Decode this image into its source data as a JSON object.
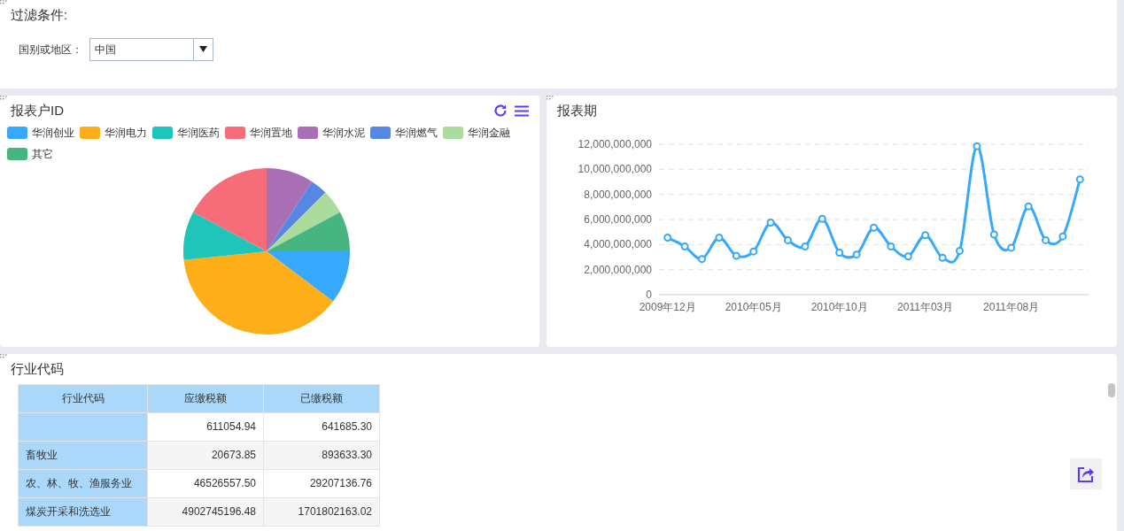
{
  "filter_panel": {
    "title": "过滤条件:",
    "field_label": "国别或地区：",
    "select_value": "中国"
  },
  "pie_panel": {
    "title": "报表户ID",
    "legend": [
      {
        "label": "华润创业",
        "color": "#36a9fd"
      },
      {
        "label": "华润电力",
        "color": "#fdae19"
      },
      {
        "label": "华润医药",
        "color": "#1ec5b8"
      },
      {
        "label": "华润置地",
        "color": "#f66c78"
      },
      {
        "label": "华润水泥",
        "color": "#a86fb5"
      },
      {
        "label": "华润燃气",
        "color": "#5687e2"
      },
      {
        "label": "华润金融",
        "color": "#abdc9e"
      },
      {
        "label": "其它",
        "color": "#47b57f"
      }
    ]
  },
  "line_panel": {
    "title": "报表期",
    "chart_data": {
      "type": "line",
      "categories": [
        "2009年12月",
        null,
        null,
        null,
        null,
        "2010年05月",
        null,
        null,
        null,
        null,
        "2010年10月",
        null,
        null,
        null,
        null,
        "2011年03月",
        null,
        null,
        null,
        null,
        "2011年08月",
        null,
        null,
        null,
        null
      ],
      "grid": true,
      "ylim": [
        0,
        12000000000
      ],
      "yticks": [
        {
          "value": 0,
          "label": "0"
        },
        {
          "value": 2000000000,
          "label": "2,000,000,000"
        },
        {
          "value": 4000000000,
          "label": "4,000,000,000"
        },
        {
          "value": 6000000000,
          "label": "6,000,000,000"
        },
        {
          "value": 8000000000,
          "label": "8,000,000,000"
        },
        {
          "value": 10000000000,
          "label": "10,000,000,000"
        },
        {
          "value": 12000000000,
          "label": "12,000,000,000"
        }
      ],
      "series": [
        {
          "color": "#36a9fd",
          "marker": "circle",
          "values": [
            4550000000,
            3850000000,
            2850000000,
            4550000000,
            3100000000,
            3450000000,
            5750000000,
            4350000000,
            3850000000,
            6050000000,
            3350000000,
            3200000000,
            5350000000,
            3850000000,
            3050000000,
            4750000000,
            2950000000,
            3500000000,
            11850000000,
            4800000000,
            3750000000,
            7050000000,
            4350000000,
            4650000000,
            9200000000
          ]
        }
      ]
    }
  },
  "table_panel": {
    "title": "行业代码",
    "columns": [
      "行业代码",
      "应缴税额",
      "已缴税额"
    ],
    "rows": [
      [
        "",
        "611054.94",
        "641685.30"
      ],
      [
        "畜牧业",
        "20673.85",
        "893633.30"
      ],
      [
        "农、林、牧、渔服务业",
        "46526557.50",
        "29207136.76"
      ],
      [
        "煤炭开采和洗选业",
        "4902745196.48",
        "1701802163.02"
      ]
    ]
  }
}
